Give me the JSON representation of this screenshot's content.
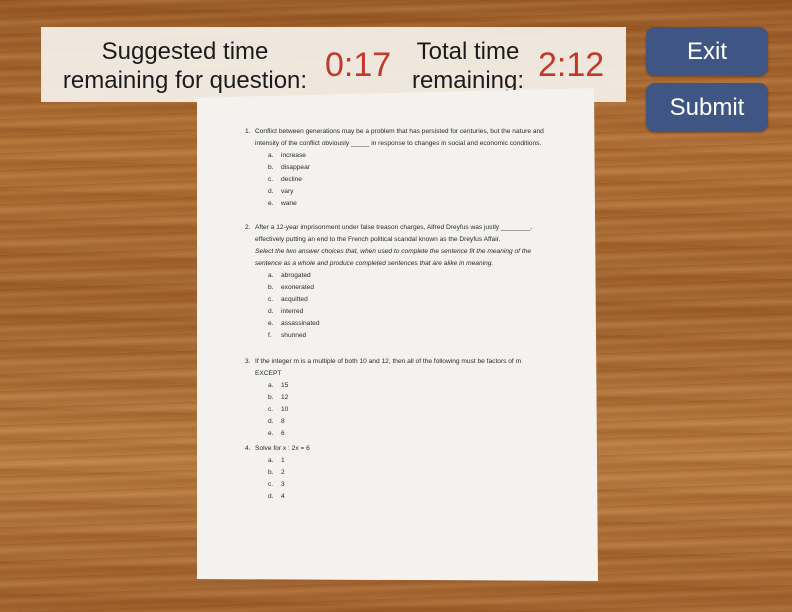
{
  "timer_panel": {
    "question_label_line1": "Suggested time",
    "question_label_line2": "remaining for question:",
    "question_time": "0:17",
    "total_label_line1": "Total time",
    "total_label_line2": "remaining:",
    "total_time": "2:12",
    "time_color": "#c0392b"
  },
  "buttons": {
    "exit_label": "Exit",
    "submit_label": "Submit",
    "color": "#3f5583"
  },
  "paper": {
    "questions": [
      {
        "number": "1.",
        "text": "Conflict between generations may be a problem that has persisted for centuries, but the nature and intensity of the conflict obviously _____ in response to changes in social and economic conditions.",
        "instruction": "",
        "choices": [
          {
            "letter": "a.",
            "text": "increase"
          },
          {
            "letter": "b.",
            "text": "disappear"
          },
          {
            "letter": "c.",
            "text": "decline"
          },
          {
            "letter": "d.",
            "text": "vary"
          },
          {
            "letter": "e.",
            "text": "wane"
          }
        ]
      },
      {
        "number": "2.",
        "text": "After a 12-year imprisonment under false treason charges, Alfred Dreyfus was justly ________, effectively putting an end to the French political scandal known as the Dreyfus Affair.",
        "instruction": "Select the two answer choices that, when used to complete the sentence fit the meaning of the sentence as a whole and produce completed sentences that are alike in meaning.",
        "choices": [
          {
            "letter": "a.",
            "text": "abrogated"
          },
          {
            "letter": "b.",
            "text": "exonerated"
          },
          {
            "letter": "c.",
            "text": "acquitted"
          },
          {
            "letter": "d.",
            "text": "interred"
          },
          {
            "letter": "e.",
            "text": "assassinated"
          },
          {
            "letter": "f.",
            "text": "shunned"
          }
        ]
      },
      {
        "number": "3.",
        "text": "If the integer m is a multiple of both 10 and 12, then all of the following must be factors of m EXCEPT",
        "instruction": "",
        "choices": [
          {
            "letter": "a.",
            "text": "15"
          },
          {
            "letter": "b.",
            "text": "12"
          },
          {
            "letter": "c.",
            "text": "10"
          },
          {
            "letter": "d.",
            "text": "8"
          },
          {
            "letter": "e.",
            "text": "6"
          }
        ]
      },
      {
        "number": "4.",
        "text": "Solve for x : 2x = 6",
        "instruction": "",
        "choices": [
          {
            "letter": "a.",
            "text": "1"
          },
          {
            "letter": "b.",
            "text": "2"
          },
          {
            "letter": "c.",
            "text": "3"
          },
          {
            "letter": "d.",
            "text": "4"
          }
        ]
      }
    ]
  }
}
